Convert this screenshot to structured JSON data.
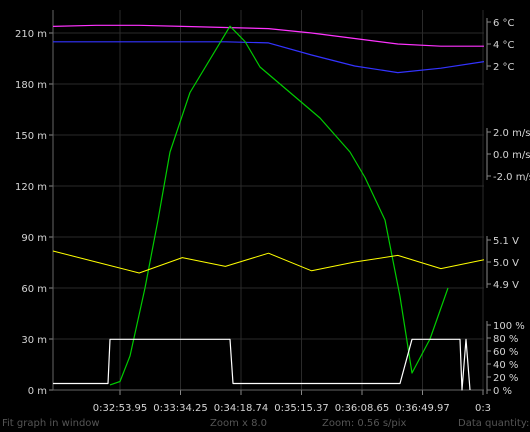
{
  "chart_data": {
    "type": "line",
    "x_ticks": [
      "0:32:53.95",
      "0:33:34.25",
      "0:34:18.74",
      "0:35:15.37",
      "0:36:08.65",
      "0:36:49.97",
      "0:3"
    ],
    "depth_axis": {
      "ticks": [
        "210 m",
        "180 m",
        "150 m",
        "120 m",
        "90 m",
        "60 m",
        "30 m",
        "0 m"
      ],
      "ylim": [
        0,
        215
      ]
    },
    "temp_axis": {
      "ticks": [
        "6 °C",
        "4 °C",
        "2 °C"
      ],
      "ylim": [
        1,
        7
      ]
    },
    "speed_axis": {
      "ticks": [
        "2.0 m/s",
        "0.0 m/s",
        "-2.0 m/s"
      ]
    },
    "voltage_axis": {
      "ticks": [
        "5.1 V",
        "5.0 V",
        "4.9 V"
      ]
    },
    "percent_axis": {
      "ticks": [
        "100 %",
        "80 %",
        "60 %",
        "40 %",
        "20 %",
        "0 %"
      ],
      "ylim": [
        0,
        100
      ]
    },
    "series": [
      {
        "color": "#ff33ff",
        "values": [
          5.6,
          5.7,
          5.7,
          5.6,
          5.5,
          5.4,
          5.0,
          4.5,
          4.0,
          3.8,
          3.8
        ]
      },
      {
        "color": "#3333ff",
        "values": [
          4.2,
          4.2,
          4.2,
          4.2,
          4.2,
          4.1,
          3.0,
          2.0,
          1.4,
          1.8,
          2.4
        ]
      },
      {
        "color": "#00cc00",
        "values": [
          3,
          5,
          20,
          60,
          100,
          140,
          175,
          214,
          205,
          190,
          180,
          170,
          160,
          150,
          140,
          125,
          100,
          55,
          10,
          30,
          60
        ]
      },
      {
        "color": "#ffff00",
        "values": [
          5.05,
          5.0,
          4.95,
          5.02,
          4.98,
          5.04,
          4.96,
          5.0,
          5.03,
          4.97,
          5.01
        ]
      },
      {
        "color": "#ffffff",
        "values": [
          10,
          10,
          10,
          78,
          78,
          78,
          78,
          78,
          10,
          10,
          10,
          10,
          10,
          10,
          10,
          78,
          78,
          0,
          78,
          0
        ]
      }
    ]
  },
  "status_bar": {
    "fit_label": "Fit graph in window",
    "zoom_label": "Zoom x 8.0",
    "zoom_rate": "Zoom: 0.56 s/pix",
    "quantity_label": "Data quantity:"
  }
}
